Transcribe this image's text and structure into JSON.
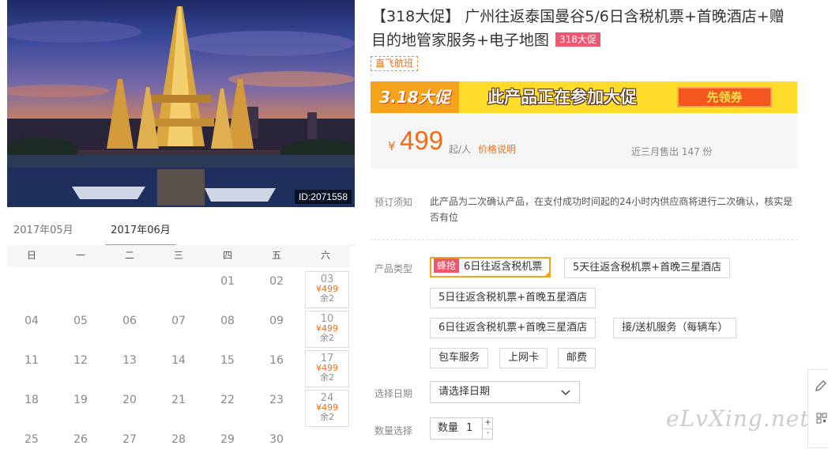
{
  "hero": {
    "id_label": "ID:2071558"
  },
  "calendar": {
    "month_prev": "2017年05月",
    "month_active": "2017年06月",
    "weekdays": [
      "日",
      "一",
      "二",
      "三",
      "四",
      "五",
      "六"
    ],
    "rows": [
      [
        "",
        "",
        "",
        "",
        "01",
        "02",
        "03"
      ],
      [
        "04",
        "05",
        "06",
        "07",
        "08",
        "09",
        "10"
      ],
      [
        "11",
        "12",
        "13",
        "14",
        "15",
        "16",
        "17"
      ],
      [
        "18",
        "19",
        "20",
        "21",
        "22",
        "23",
        "24"
      ],
      [
        "25",
        "26",
        "27",
        "28",
        "29",
        "30",
        ""
      ]
    ],
    "avail_price": "¥499",
    "avail_stock": "余2"
  },
  "product": {
    "title": "【318大促】 广州往返泰国曼谷5/6日含税机票+首晚酒店+赠目的地管家服务+电子地图",
    "title_badge": "318大促",
    "direct_tag": "直飞航班",
    "promo": {
      "left": "3.18大促",
      "mid": "此产品正在参加大促",
      "button": "先领券"
    },
    "price": {
      "currency": "¥",
      "amount": "499",
      "unit": "起/人",
      "explain_link": "价格说明",
      "sold": "近三月售出 147 份"
    },
    "notice_label": "预订须知",
    "notice_text": "此产品为二次确认产品，在支付成功时间起的24小时内供应商将进行二次确认，核实是否有位",
    "type_label": "产品类型",
    "options": {
      "o1_tag": "蜂抢",
      "o1": "6日往返含税机票",
      "o2": "5天往返含税机票+首晚三星酒店",
      "o3": "5日往返含税机票+首晚五星酒店",
      "o4": "6日往返含税机票+首晚三星酒店",
      "o5": "接/送机服务（每辆车）",
      "o6": "包车服务",
      "o7": "上网卡",
      "o8": "邮费"
    },
    "date_label": "选择日期",
    "date_placeholder": "请选择日期",
    "qty_label": "数量选择",
    "qty_inner_label": "数量",
    "qty_value": "1",
    "plus": "+",
    "minus": "-"
  },
  "watermark": "eLvXing.net",
  "icons": [
    "chevron-down-icon",
    "edit-icon",
    "qr-icon"
  ]
}
